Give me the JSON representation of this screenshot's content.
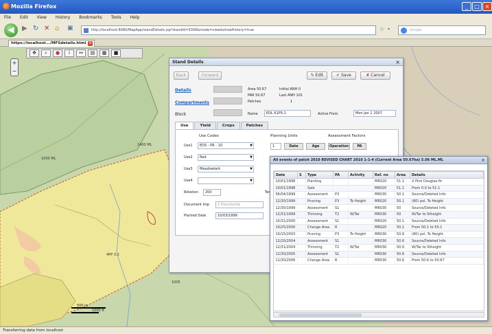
{
  "window": {
    "title": "Mozilla Firefox"
  },
  "menu": [
    "File",
    "Edit",
    "View",
    "History",
    "Bookmarks",
    "Tools",
    "Help"
  ],
  "nav": {
    "address": "http://localhost:8080/MapApp/standDetails.jsp?standId=5009&mode=view&showHistory=true",
    "search_placeholder": "Google"
  },
  "tab": {
    "label": "https://localhost.../MFSdetails.html"
  },
  "map": {
    "labels": [
      "1000 ML",
      "2400 ML",
      "4PP 3.2",
      "1005"
    ],
    "scale": [
      "500 m",
      "1000 ft"
    ]
  },
  "stand_dialog": {
    "title": "Stand Details",
    "buttons": {
      "back": "Back",
      "forward": "Forward",
      "edit": "Edit",
      "save": "Save",
      "cancel": "Cancel"
    },
    "details_link": "Details",
    "compartments_link": "Compartments",
    "block_label": "Block",
    "info_col1": [
      "Area 50.67",
      "PAR 50.67",
      "Patches"
    ],
    "info_col2": [
      "Initial ANH 0",
      "Last ANH 101",
      "1"
    ],
    "name_label": "Name",
    "name_value": "EDL 61PS-1",
    "active_from_label": "Active From",
    "active_from_value": "Mon Jan 1 2007",
    "tabs": [
      "Use",
      "Yield",
      "Crops",
      "Patches"
    ],
    "use_header": "Use Codes",
    "planning_header": "Planning Units",
    "assessment_header": "Assessment Factors",
    "use_rows": [
      {
        "label": "Use1",
        "value": "EDS - PR - 10"
      },
      {
        "label": "Use2",
        "value": "Red"
      },
      {
        "label": "Use3",
        "value": "Meadowlark"
      },
      {
        "label": "Use4",
        "value": ""
      }
    ],
    "planning_value": "1",
    "col_buttons": [
      "Date",
      "Age",
      "Operation",
      "PA"
    ],
    "rotation_label": "Rotation",
    "rotation_value": "200",
    "tending_label": "Tending",
    "document_label": "Document Imp",
    "document_value": "2 Documents",
    "planted_label": "Planted Date",
    "planted_value": "10/03/1999"
  },
  "history_dialog": {
    "title": "All events of patch 2010 REVISED CHART 2010 1-1-4 (Current Area 50.67ha) 5.06 ML.ML",
    "columns": [
      "Date",
      "S",
      "Type",
      "PA",
      "Activity",
      "Ref. no",
      "Area",
      "Details"
    ],
    "rows": [
      [
        "10/01/1998",
        "",
        "Planting",
        "",
        "",
        "MR020",
        "51.1",
        "X Pink Douglas-fir"
      ],
      [
        "10/01/1998",
        "",
        "Sale",
        "",
        "",
        "MR020",
        "51.1",
        "From 0.0 to 51.1"
      ],
      [
        "06/04/1999",
        "",
        "Assessment",
        "P3",
        "",
        "MR030",
        "50.1",
        "Source/Deleted Info"
      ],
      [
        "12/30/1999",
        "",
        "Pruning",
        "P3",
        "To Height",
        "MR020",
        "50.1",
        "(80) pol. To Height"
      ],
      [
        "12/30/1999",
        "",
        "Assessment",
        "S1",
        "",
        "MR030",
        "50",
        "Source/Deleted Info"
      ],
      [
        "12/31/1999",
        "",
        "Thinning",
        "T2",
        "W/Tar",
        "MR030",
        "50",
        "W/Tar to Stheight"
      ],
      [
        "10/31/2000",
        "",
        "Assessment",
        "S1",
        "",
        "MR020",
        "50.1",
        "Source/Deleted Info"
      ],
      [
        "10/25/2000",
        "",
        "Change Area",
        "R",
        "",
        "MR020",
        "50.1",
        "From 50.1 to 50.1"
      ],
      [
        "10/15/2003",
        "",
        "Pruning",
        "P3",
        "To Height",
        "MR030",
        "50.6",
        "(80) pol. To Height"
      ],
      [
        "12/20/2004",
        "",
        "Assessment",
        "S1",
        "",
        "MR030",
        "50.6",
        "Source/Deleted Info"
      ],
      [
        "12/31/2004",
        "",
        "Thinning",
        "T2",
        "W/Tar",
        "MR030",
        "50.6",
        "W/Tar to Stheight"
      ],
      [
        "12/30/2005",
        "",
        "Assessment",
        "S1",
        "",
        "MR030",
        "50.6",
        "Source/Deleted Info"
      ],
      [
        "11/30/2006",
        "",
        "Change Area",
        "R",
        "",
        "MR030",
        "50.6",
        "From 50.6 to 50.67"
      ]
    ]
  },
  "status": "Transferring data from localhost"
}
